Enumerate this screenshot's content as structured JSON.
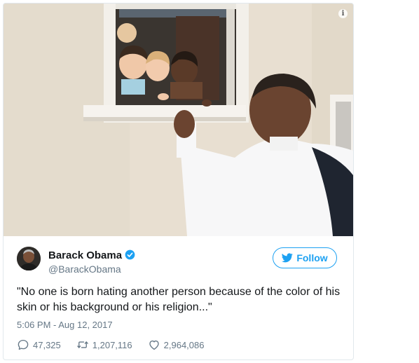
{
  "photo": {
    "alt_subject": "photo",
    "info_icon": "info-icon"
  },
  "author": {
    "name": "Barack Obama",
    "handle": "@BarackObama",
    "verified_icon": "verified-badge-icon",
    "avatar_icon": "avatar"
  },
  "follow": {
    "label": "Follow",
    "icon": "twitter-bird-icon",
    "color": "#1da1f2"
  },
  "tweet": {
    "text": "\"No one is born hating another person because of the color of his skin or his background or his religion...\"",
    "timestamp": "5:06 PM - Aug 12, 2017"
  },
  "actions": {
    "replies": "47,325",
    "retweets": "1,207,116",
    "likes": "2,964,086"
  }
}
